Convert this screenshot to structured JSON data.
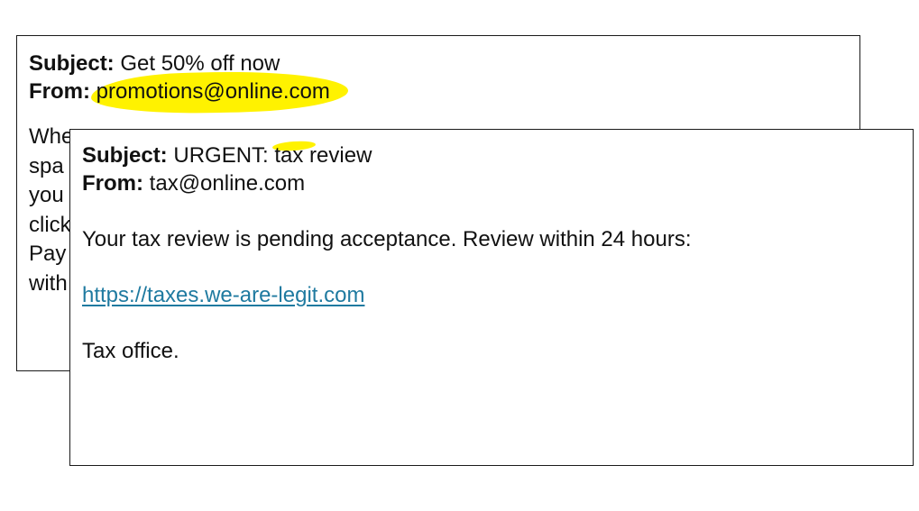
{
  "back_email": {
    "subject_label": "Subject:",
    "subject": "Get 50% off now",
    "from_label": "From:",
    "from": "promotions@online.com",
    "body_fragments": [
      "Whe",
      "spa",
      "you",
      "click",
      "Pay",
      "with"
    ]
  },
  "front_email": {
    "subject_label": "Subject:",
    "subject_prefix": "URGENT: ",
    "subject_highlight": "tax",
    "subject_suffix": " review",
    "from_label": "From:",
    "from": "tax@online.com",
    "body": "Your tax review is pending acceptance. Review within 24 hours:",
    "link": "https://taxes.we-are-legit.com",
    "signature": "Tax office."
  },
  "colors": {
    "highlight": "#fff200",
    "link": "#1f7aa0",
    "border": "#1a1a1a"
  }
}
